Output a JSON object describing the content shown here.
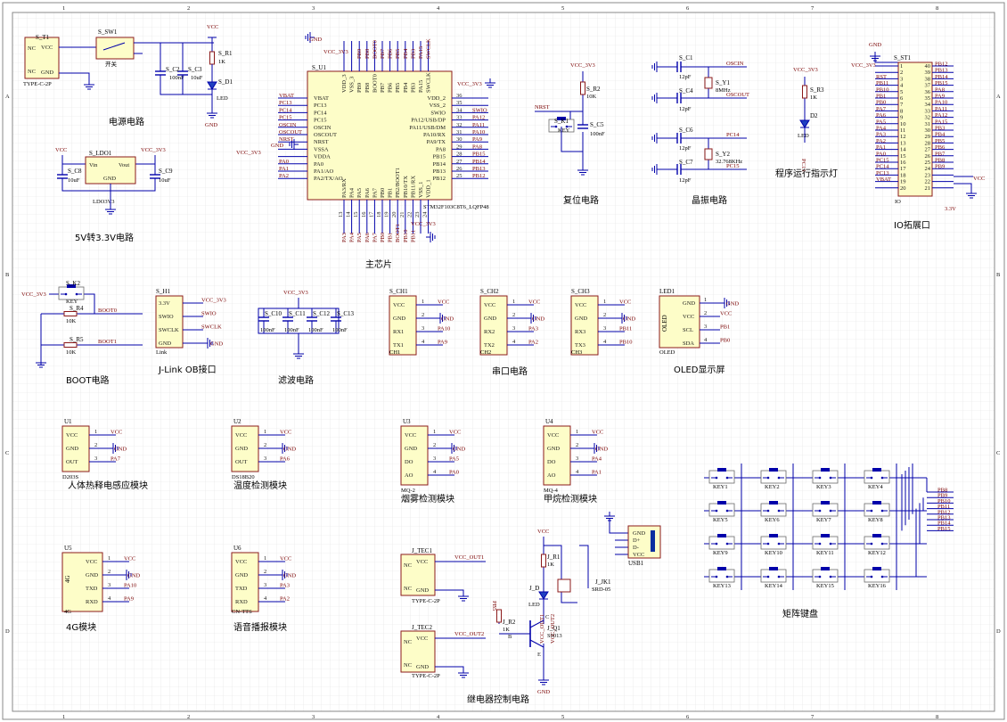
{
  "frame": {
    "columns": [
      "1",
      "2",
      "3",
      "4",
      "5",
      "6",
      "7",
      "8"
    ],
    "rows": [
      "A",
      "B",
      "C",
      "D"
    ]
  },
  "titles": {
    "power": "电源电路",
    "ldo": "5V转3.3V电路",
    "mcu": "主芯片",
    "reset": "复位电路",
    "crystal": "晶振电路",
    "indicator": "程序运行指示灯",
    "io": "IO拓展口",
    "boot": "BOOT电路",
    "jlink": "J-Link OB接口",
    "filter": "滤波电路",
    "uart": "串口电路",
    "oled": "OLED显示屏",
    "pir": "人体热释电感应模块",
    "temp": "温度检测模块",
    "smoke": "烟雾检测模块",
    "methane": "甲烷检测模块",
    "g4": "4G模块",
    "voice": "语音播报模块",
    "relay": "继电器控制电路",
    "keypad": "矩阵键盘"
  },
  "power": {
    "t1": {
      "ref": "S_T1",
      "type": "TYPE-C-2P",
      "pins": [
        "NC",
        "VCC",
        "NC",
        "GND"
      ]
    },
    "sw": {
      "ref": "S_SW1",
      "label": "开关"
    },
    "c2": {
      "ref": "S_C2",
      "value": "100nF"
    },
    "c3": {
      "ref": "S_C3",
      "value": "10uF"
    },
    "r1": {
      "ref": "S_R1",
      "value": "1K"
    },
    "d1": {
      "ref": "S_D1",
      "value": "LED"
    },
    "vcc": "VCC",
    "gnd": "GND"
  },
  "ldo": {
    "ref": "S_LDO1",
    "part": "LDO3V3",
    "pins": [
      "Vin",
      "GND",
      "Vout"
    ],
    "c8": {
      "ref": "S_C8",
      "value": "10uF"
    },
    "c9": {
      "ref": "S_C9",
      "value": "10uF"
    },
    "vin": "VCC",
    "vout": "VCC_3V3"
  },
  "mcu": {
    "ref": "S_U1",
    "part": "STM32F103C8T6_LQFP48",
    "left_pins": [
      "VBAT",
      "PC13",
      "PC14",
      "PC15",
      "OSCIN",
      "OSCOUT",
      "NRST",
      "VSSA",
      "VDDA",
      "PA0",
      "PA1/AO",
      "PA2/TX/AO"
    ],
    "left_nets": [
      "VBAT",
      "PC13",
      "PC14",
      "PC15",
      "OSCIN",
      "OSCOUT",
      "NRST",
      "GND",
      "VCC_3V3",
      "PA0",
      "PA1",
      "PA2"
    ],
    "right_pins": [
      "VDD_2",
      "VSS_2",
      "SWIO",
      "PA12/USB/DP",
      "PA11/USB/DM",
      "PA10/RX",
      "PA9/TX",
      "PA8",
      "PB15",
      "PB14",
      "PB13",
      "PB12"
    ],
    "right_nums": [
      "36",
      "35",
      "34",
      "33",
      "32",
      "31",
      "30",
      "29",
      "28",
      "27",
      "26",
      "25"
    ],
    "right_nets": [
      "VCC_3V3",
      "",
      "SWIO",
      "PA12",
      "PA11",
      "PA10",
      "PA9",
      "PA8",
      "PB15",
      "PB14",
      "PB13",
      "PB12"
    ],
    "top_pins": [
      "VDD_3",
      "VSS_3",
      "PB9",
      "PB8",
      "BOOT0",
      "PB7",
      "PB6",
      "PB5",
      "PB4",
      "PB3",
      "PA15",
      "SWCLK"
    ],
    "top_nets": [
      "VCC_3V3",
      "GND",
      "PB9",
      "PB8",
      "BOOT0",
      "PB7",
      "PB6",
      "PB5",
      "PB4",
      "PB3",
      "PA15",
      "SWCLK"
    ],
    "bottom_pins": [
      "PA3/RX",
      "PA4",
      "PA5",
      "PA6",
      "PA7",
      "PB0",
      "PB1",
      "PB2/BOOT1",
      "PB10/TX",
      "PB11/RX",
      "VSS_1",
      "VDD_1"
    ],
    "bottom_nets": [
      "PA3",
      "PA4",
      "PA5",
      "PA6",
      "PA7",
      "PB0",
      "PB1",
      "BOOT1",
      "PB10",
      "PB11",
      "GND",
      "VCC_3V3"
    ],
    "bottom_nums": [
      "13",
      "14",
      "15",
      "16",
      "17",
      "18",
      "19",
      "20",
      "21",
      "22",
      "23",
      "24"
    ]
  },
  "reset": {
    "k1": {
      "ref": "S_K1",
      "label": "KEY"
    },
    "r2": {
      "ref": "S_R2",
      "value": "10K"
    },
    "c5": {
      "ref": "S_C5",
      "value": "100nF"
    },
    "net": "NRST",
    "vcc": "VCC_3V3"
  },
  "crystal": {
    "c1": {
      "ref": "S_C1",
      "value": "12pF"
    },
    "c4": {
      "ref": "S_C4",
      "value": "12pF"
    },
    "c6": {
      "ref": "S_C6",
      "value": "12pF"
    },
    "c7": {
      "ref": "S_C7",
      "value": "12pF"
    },
    "y1": {
      "ref": "S_Y1",
      "value": "8MHz"
    },
    "y2": {
      "ref": "S_Y2",
      "value": "32.768KHz"
    },
    "nets": [
      "OSCIN",
      "OSCOUT",
      "PC14",
      "PC15"
    ]
  },
  "indicator": {
    "r3": {
      "ref": "S_R3",
      "value": "1K"
    },
    "d2": {
      "ref": "D2",
      "value": "LED"
    },
    "vcc": "VCC_3V3",
    "net": "PC13"
  },
  "io": {
    "ref": "S_ST1",
    "part": "IO",
    "left": [
      [
        "VCC_3V3",
        "1"
      ],
      [
        "GND",
        "2"
      ],
      [
        "RST",
        "3"
      ],
      [
        "PB11",
        "4"
      ],
      [
        "PB10",
        "5"
      ],
      [
        "PB1",
        "6"
      ],
      [
        "PB0",
        "7"
      ],
      [
        "PA7",
        "8"
      ],
      [
        "PA6",
        "9"
      ],
      [
        "PA5",
        "10"
      ],
      [
        "PA4",
        "11"
      ],
      [
        "PA3",
        "12"
      ],
      [
        "PA2",
        "13"
      ],
      [
        "PA1",
        "14"
      ],
      [
        "PA0",
        "15"
      ],
      [
        "PC15",
        "16"
      ],
      [
        "PC14",
        "17"
      ],
      [
        "PC13",
        "18"
      ],
      [
        "VBAT",
        "19"
      ],
      [
        "",
        "20"
      ]
    ],
    "right": [
      [
        "40",
        "PB12"
      ],
      [
        "39",
        "PB13"
      ],
      [
        "38",
        "PB14"
      ],
      [
        "37",
        "PB15"
      ],
      [
        "36",
        "PA8"
      ],
      [
        "35",
        "PA9"
      ],
      [
        "34",
        "PA10"
      ],
      [
        "33",
        "PA11"
      ],
      [
        "32",
        "PA12"
      ],
      [
        "31",
        "PA15"
      ],
      [
        "30",
        "PB3"
      ],
      [
        "29",
        "PB4"
      ],
      [
        "28",
        "PB5"
      ],
      [
        "27",
        "PB6"
      ],
      [
        "26",
        "PB7"
      ],
      [
        "25",
        "PB8"
      ],
      [
        "24",
        "PB9"
      ],
      [
        "23",
        ""
      ],
      [
        "22",
        ""
      ],
      [
        "21",
        ""
      ]
    ],
    "gnd": "GND",
    "vcc": "VCC",
    "v33": "3.3V"
  },
  "boot": {
    "k2": {
      "ref": "S_K2",
      "label": "KEY"
    },
    "r4": {
      "ref": "S_R4",
      "value": "10K"
    },
    "r5": {
      "ref": "S_R5",
      "value": "10K"
    },
    "nets": [
      "BOOT0",
      "BOOT1"
    ],
    "vcc": "VCC_3V3"
  },
  "jlink": {
    "ref": "S_H1",
    "part": "Link",
    "pins": [
      "3.3V",
      "SWIO",
      "SWCLK",
      "GND"
    ],
    "nets": [
      "VCC_3V3",
      "SWIO",
      "SWCLK",
      "GND"
    ]
  },
  "filter": {
    "caps": [
      {
        "ref": "S_C10",
        "value": "100nF"
      },
      {
        "ref": "S_C11",
        "value": "100nF"
      },
      {
        "ref": "S_C12",
        "value": "100nF"
      },
      {
        "ref": "S_C13",
        "value": "100nF"
      }
    ],
    "vcc": "VCC_3V3"
  },
  "uart": [
    {
      "ref": "S_CH1",
      "part": "CH1",
      "pins": [
        "VCC",
        "GND",
        "RX1",
        "TX1"
      ],
      "nets": [
        "VCC",
        "GND",
        "PA10",
        "PA9"
      ]
    },
    {
      "ref": "S_CH2",
      "part": "CH2",
      "pins": [
        "VCC",
        "GND",
        "RX2",
        "TX2"
      ],
      "nets": [
        "VCC",
        "GND",
        "PA3",
        "PA2"
      ]
    },
    {
      "ref": "S_CH3",
      "part": "CH3",
      "pins": [
        "VCC",
        "GND",
        "RX3",
        "TX3"
      ],
      "nets": [
        "VCC",
        "GND",
        "PB11",
        "PB10"
      ]
    }
  ],
  "oled": {
    "ref": "LED1",
    "part": "OLED",
    "label": "OLED",
    "pins": [
      "GND",
      "VCC",
      "SCL",
      "SDA"
    ],
    "nets": [
      "GND",
      "VCC",
      "PB1",
      "PB0"
    ]
  },
  "sensors": [
    {
      "ref": "U1",
      "part": "D203S",
      "pins": [
        "VCC",
        "GND",
        "OUT"
      ],
      "nets": [
        "VCC",
        "GND",
        "PA7"
      ]
    },
    {
      "ref": "U2",
      "part": "DS18B20",
      "pins": [
        "VCC",
        "GND",
        "OUT"
      ],
      "nets": [
        "VCC",
        "GND",
        "PA6"
      ]
    },
    {
      "ref": "U3",
      "part": "MQ-2",
      "pins": [
        "VCC",
        "GND",
        "DO",
        "AO"
      ],
      "nets": [
        "VCC",
        "GND",
        "PA5",
        "PA0"
      ]
    },
    {
      "ref": "U4",
      "part": "MQ-4",
      "pins": [
        "VCC",
        "GND",
        "DO",
        "AO"
      ],
      "nets": [
        "VCC",
        "GND",
        "PA4",
        "PA1"
      ]
    }
  ],
  "g4": {
    "ref": "U5",
    "part": "4G",
    "label": "4G",
    "pins": [
      "VCC",
      "GND",
      "TXD",
      "RXD"
    ],
    "nets": [
      "VCC",
      "GND",
      "PA10",
      "PA9"
    ]
  },
  "voice": {
    "ref": "U6",
    "part": "CN-TTS",
    "pins": [
      "VCC",
      "GND",
      "TXD",
      "RXD"
    ],
    "nets": [
      "VCC",
      "GND",
      "PA3",
      "PA2"
    ]
  },
  "relay": {
    "tec1": {
      "ref": "J_TEC1",
      "type": "TYPE-C-2P",
      "pins": [
        "NC",
        "VCC",
        "NC",
        "GND"
      ],
      "net": "VCC_OUT1"
    },
    "tec2": {
      "ref": "J_TEC2",
      "type": "TYPE-C-2P",
      "pins": [
        "NC",
        "VCC",
        "NC",
        "GND"
      ],
      "net": "VCC_OUT2"
    },
    "r1": {
      "ref": "J_R1",
      "value": "1K"
    },
    "r2": {
      "ref": "J_R2",
      "value": "1K"
    },
    "d": {
      "ref": "J_D",
      "value": "LED"
    },
    "q1": {
      "ref": "J_Q1",
      "value": "S9013",
      "pins": [
        "B",
        "C",
        "E"
      ]
    },
    "jk1": {
      "ref": "J_JK1",
      "value": "SRD-05"
    },
    "usb": {
      "ref": "USB1",
      "pins": [
        "GND",
        "D+",
        "D-",
        "VCC"
      ]
    },
    "vertical_nets": [
      "VCC_OUT1",
      "VCC_OUT2"
    ],
    "vcc": "VCC",
    "gnd": "GND",
    "ctrl": "PB5"
  },
  "keypad": {
    "keys": [
      "KEY1",
      "KEY2",
      "KEY3",
      "KEY4",
      "KEY5",
      "KEY6",
      "KEY7",
      "KEY8",
      "KEY9",
      "KEY10",
      "KEY11",
      "KEY12",
      "KEY13",
      "KEY14",
      "KEY15",
      "KEY16"
    ],
    "nets": [
      "PB8",
      "PB9",
      "PB10",
      "PB11",
      "PB12",
      "PB13",
      "PB14",
      "PB15"
    ]
  }
}
